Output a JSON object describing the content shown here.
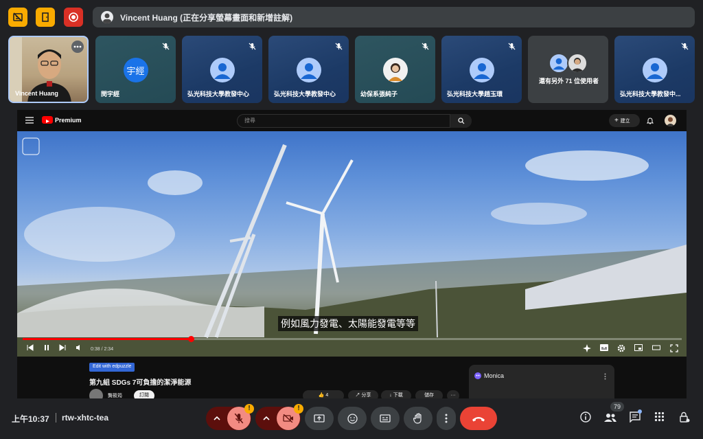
{
  "topbar": {
    "presenter_text": "Vincent Huang (正在分享螢幕畫面和新增註解)"
  },
  "tiles": [
    {
      "name": "Vincent Huang"
    },
    {
      "name": "閔宇經",
      "avatar_text": "宇經"
    },
    {
      "name": "弘光科技大學教發中心"
    },
    {
      "name": "弘光科技大學教發中心"
    },
    {
      "name": "幼保系張純子"
    },
    {
      "name": "弘光科技大學趙玉環"
    },
    {
      "name": "還有另外 71 位使用者"
    },
    {
      "name": "弘光科技大學教發中..."
    }
  ],
  "youtube": {
    "logo": "Premium",
    "search_placeholder": "搜尋",
    "create_label": "建立",
    "caption": "例如風力發電、太陽能發電等等",
    "time": "0:38 / 2:34",
    "progress": 0.255,
    "edpuzzle_label": "Edit with edpuzzle",
    "video_title": "第九組 SDGs 7可負擔的潔淨能源",
    "channel_name": "龔筱筠",
    "subscribe_label": "訂閱",
    "like_count": "4",
    "share_label": "分享",
    "download_label": "下載",
    "save_label": "儲存",
    "monica_label": "Monica"
  },
  "bottom": {
    "time": "上午10:37",
    "meeting_code": "rtw-xhtc-tea",
    "participants_count": "79"
  },
  "colors": {
    "accent_red": "#ea4335",
    "warn_yellow": "#f9ab00",
    "tile_blue": "#1c3a66"
  }
}
